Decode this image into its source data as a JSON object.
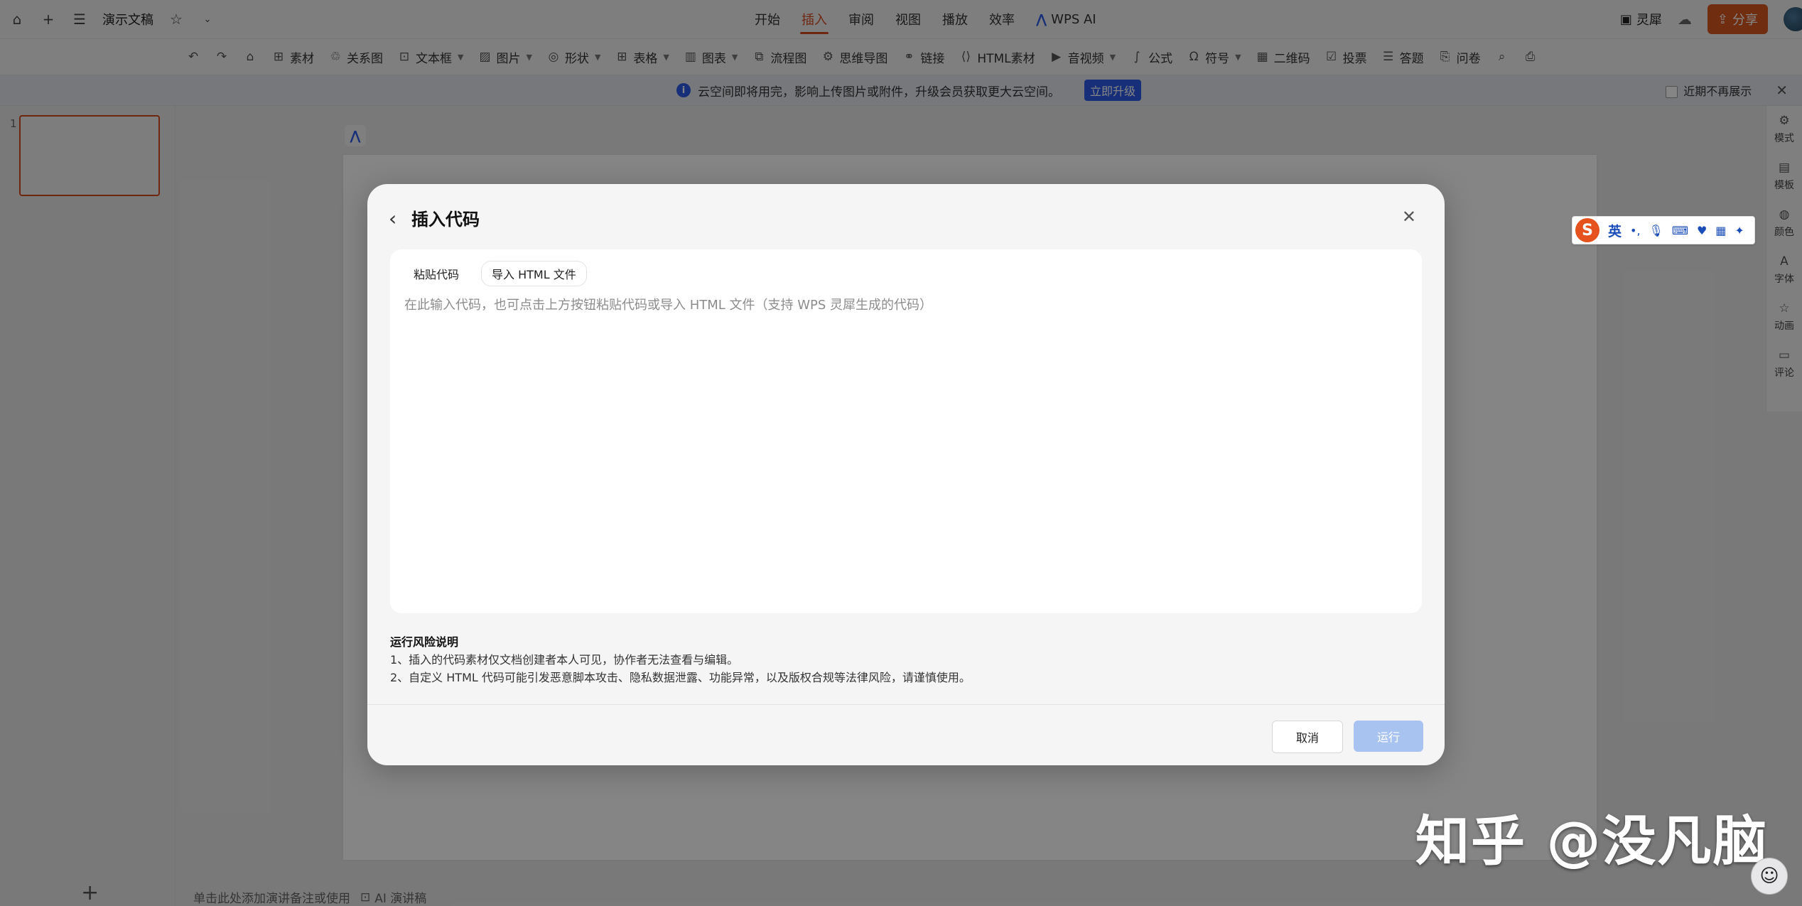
{
  "titlebar": {
    "doc_title": "演示文稿",
    "menu_tabs": [
      "开始",
      "插入",
      "审阅",
      "视图",
      "播放",
      "效率",
      "WPS AI"
    ],
    "active_tab": "插入",
    "lingxi_label": "灵犀",
    "share_label": "分享"
  },
  "toolbar": {
    "items": [
      "素材",
      "关系图",
      "文本框",
      "图片",
      "形状",
      "表格",
      "图表",
      "流程图",
      "思维导图",
      "链接",
      "HTML素材",
      "音视频",
      "公式",
      "符号",
      "二维码",
      "投票",
      "答题",
      "问卷"
    ]
  },
  "notice": {
    "message": "云空间即将用完，影响上传图片或附件，升级会员获取更大云空间。",
    "upgrade_label": "立即升级",
    "dont_remind_label": "近期不再展示"
  },
  "slides": {
    "current_number": "1"
  },
  "notes": {
    "hint": "单击此处添加演讲备注或使用",
    "ai_label": "AI 演讲稿"
  },
  "rightbar": {
    "items": [
      "模式",
      "模板",
      "颜色",
      "字体",
      "动画",
      "评论"
    ]
  },
  "ime": {
    "lang": "英"
  },
  "modal": {
    "title": "插入代码",
    "tab_paste": "粘贴代码",
    "tab_import": "导入 HTML 文件",
    "placeholder": "在此输入代码，也可点击上方按钮粘贴代码或导入 HTML 文件（支持 WPS 灵犀生成的代码）",
    "risk_title": "运行风险说明",
    "risk_line1": "1、插入的代码素材仅文档创建者本人可见，协作者无法查看与编辑。",
    "risk_line2": "2、自定义 HTML 代码可能引发恶意脚本攻击、隐私数据泄露、功能异常，以及版权合规等法律风险，请谨慎使用。",
    "cancel_label": "取消",
    "run_label": "运行"
  },
  "watermark": {
    "text": "知乎 @没凡脑"
  },
  "colors": {
    "accent": "#d44a1f",
    "primary_blue": "#2b5ae6",
    "run_disabled": "#a9c3f1"
  }
}
